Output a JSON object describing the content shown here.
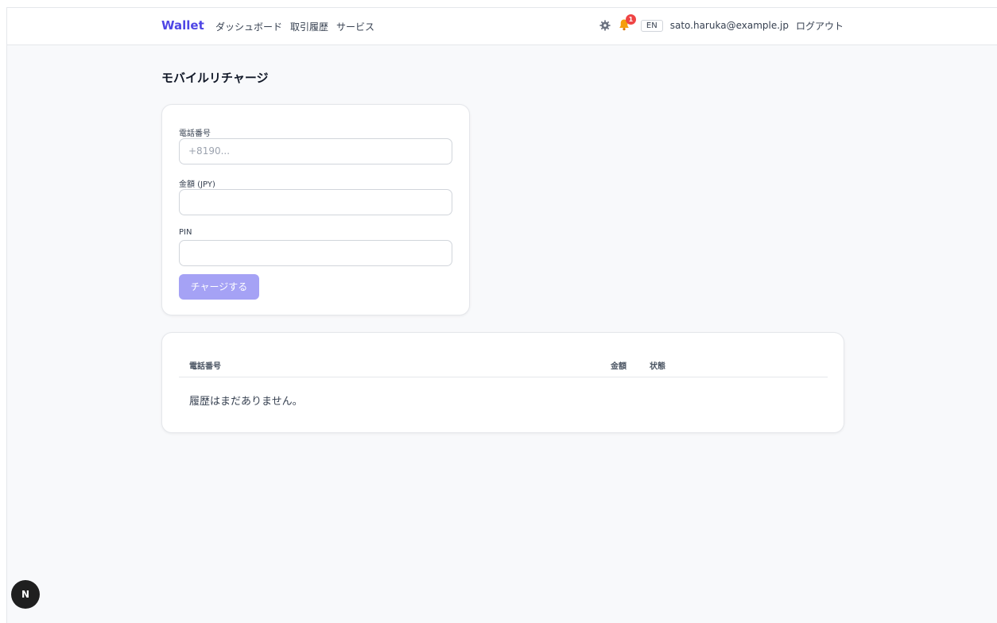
{
  "nav": {
    "brand": "Wallet",
    "links": [
      "ダッシュボード",
      "取引履歴",
      "サービス"
    ],
    "notification_count": "1",
    "lang": "EN",
    "user_email": "sato.haruka@example.jp",
    "logout": "ログアウト"
  },
  "page": {
    "title": "モバイルリチャージ"
  },
  "form": {
    "phone_label": "電話番号",
    "phone_placeholder": "+8190...",
    "amount_label": "金額 (JPY)",
    "pin_label": "PIN",
    "submit": "チャージする"
  },
  "history": {
    "headers": [
      "電話番号",
      "金額",
      "状態"
    ],
    "empty": "履歴はまだありません。"
  },
  "dev_badge": "N",
  "colors": {
    "accent": "#4f46e5",
    "button_disabled": "#a5a2f5",
    "badge": "#ef4444"
  },
  "icons": [
    "settings-icon",
    "bell-icon"
  ]
}
